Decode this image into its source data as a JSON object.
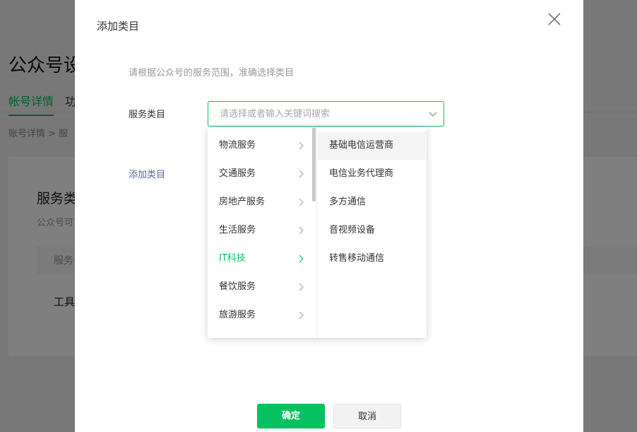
{
  "background": {
    "title": "公众号设",
    "tabs": [
      "帐号详情",
      "功"
    ],
    "breadcrumb": "账号详情 > 服",
    "card_title": "服务类",
    "card_sub": "公众号可",
    "table_head": "服务",
    "table_row": "工具"
  },
  "dialog": {
    "title": "添加类目",
    "hint": "请根据公众号的服务范围，准确选择类目",
    "field_label": "服务类目",
    "search_placeholder": "请选择或者输入关键词搜索",
    "add_category": "添加类目",
    "confirm": "确定",
    "cancel": "取消"
  },
  "cascader": {
    "level1": [
      {
        "label": "物流服务",
        "active": false
      },
      {
        "label": "交通服务",
        "active": false
      },
      {
        "label": "房地产服务",
        "active": false
      },
      {
        "label": "生活服务",
        "active": false
      },
      {
        "label": "IT科技",
        "active": true
      },
      {
        "label": "餐饮服务",
        "active": false
      },
      {
        "label": "旅游服务",
        "active": false
      }
    ],
    "level2": [
      {
        "label": "基础电信运营商",
        "hovered": true
      },
      {
        "label": "电信业务代理商",
        "hovered": false
      },
      {
        "label": "多方通信",
        "hovered": false
      },
      {
        "label": "音视频设备",
        "hovered": false
      },
      {
        "label": "转售移动通信",
        "hovered": false
      }
    ]
  },
  "icons": {
    "close": "close-icon",
    "dropdown_arrow": "chevron-down-icon",
    "submenu_arrow": "chevron-right-icon"
  },
  "colors": {
    "accent": "#07c160",
    "link": "#576b95"
  }
}
